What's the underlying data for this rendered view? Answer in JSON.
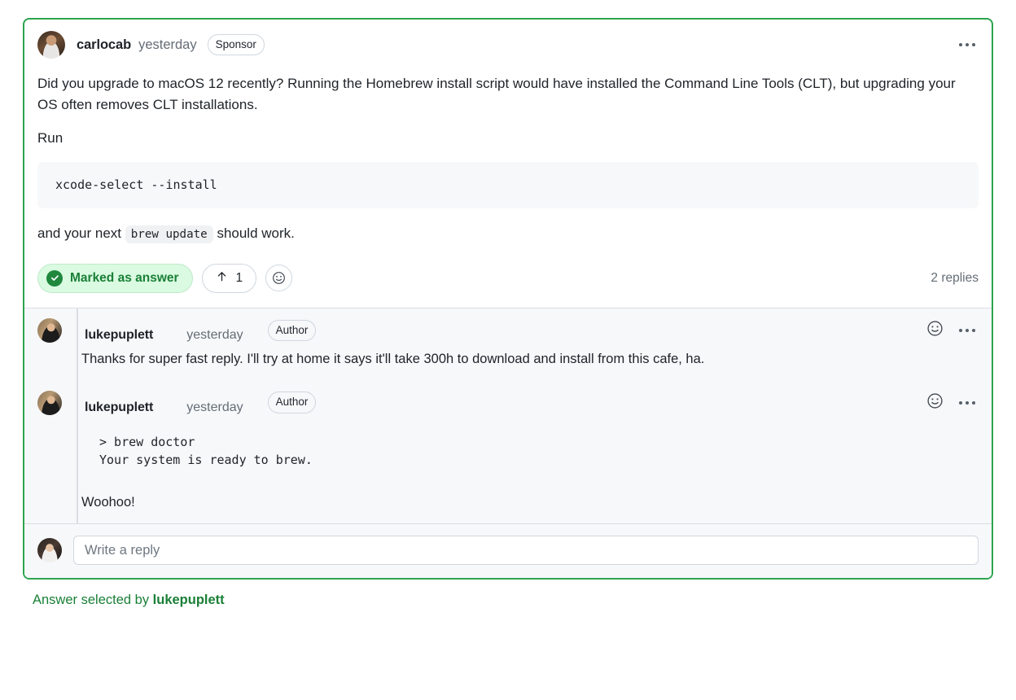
{
  "answer": {
    "author": "carlocab",
    "timestamp": "yesterday",
    "badge": "Sponsor",
    "paragraph_1": "Did you upgrade to macOS 12 recently? Running the Homebrew install script would have installed the Command Line Tools (CLT), but upgrading your OS often removes CLT installations.",
    "paragraph_2": "Run",
    "code_block": "xcode-select --install",
    "paragraph_3_prefix": "and your next ",
    "paragraph_3_code": "brew update",
    "paragraph_3_suffix": " should work.",
    "menu_icon": "kebab-menu-icon",
    "actions": {
      "marked_as_answer": "Marked as answer",
      "check_icon": "check-icon",
      "upvote_icon": "up-arrow-icon",
      "upvote_count": "1",
      "add_reaction_icon": "smiley-icon",
      "replies_count": "2 replies"
    }
  },
  "replies": [
    {
      "author": "lukepuplett",
      "timestamp": "yesterday",
      "badge": "Author",
      "text": "Thanks for super fast reply. I'll try at home it says it'll take 300h to download and install from this cafe, ha.",
      "reaction_icon": "smiley-icon",
      "menu_icon": "kebab-menu-icon"
    },
    {
      "author": "lukepuplett",
      "timestamp": "yesterday",
      "badge": "Author",
      "code": "> brew doctor\nYour system is ready to brew.",
      "text": "Woohoo!",
      "reaction_icon": "smiley-icon",
      "menu_icon": "kebab-menu-icon"
    }
  ],
  "reply_form": {
    "placeholder": "Write a reply"
  },
  "footer": {
    "prefix": "Answer selected by ",
    "user": "lukepuplett"
  },
  "colors": {
    "accent_green": "#2da44e",
    "answer_pill_bg": "#dafbe1",
    "answer_pill_text": "#1a7f37",
    "replies_bg": "#f6f8fa",
    "border": "#d0d7de"
  }
}
